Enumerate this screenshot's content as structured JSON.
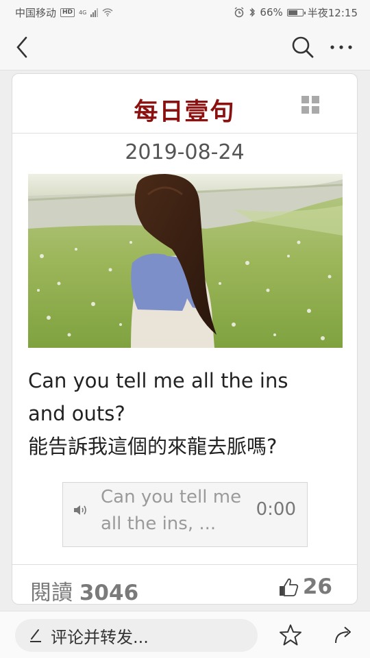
{
  "status_bar": {
    "carrier": "中国移动",
    "hd": "HD",
    "network": "4G",
    "battery_percent": "66%",
    "battery_level": 0.66,
    "time": "半夜12:15"
  },
  "nav": {
    "back_icon": "chevron-left-icon",
    "search_icon": "search-icon",
    "more_icon": "more-dots-icon"
  },
  "card": {
    "title": "每日壹句",
    "date": "2019-08-24",
    "quote_en_line1": "Can you tell me all the ins",
    "quote_en_line2": "and outs?",
    "quote_zh": "能告訴我這個的來龍去脈嗎?",
    "audio": {
      "text_line1": "Can you tell me",
      "text_line2": "all the ins, ...",
      "time": "0:00"
    },
    "reads_label": "閱讀",
    "reads_count": "3046",
    "likes_count": "26"
  },
  "bottom_bar": {
    "comment_placeholder": "评论并转发..."
  },
  "colors": {
    "title": "#8b1010",
    "background": "#eeeeee",
    "card": "#ffffff"
  }
}
